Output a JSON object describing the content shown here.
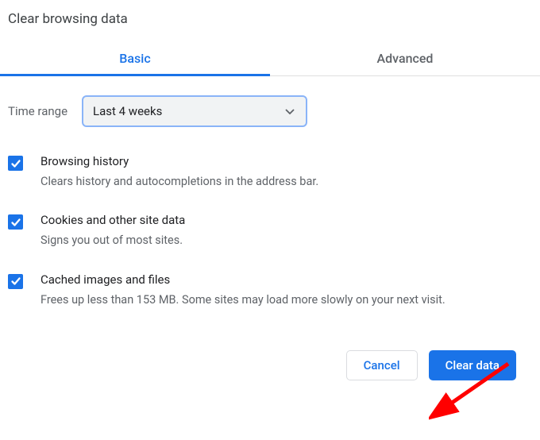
{
  "dialog": {
    "title": "Clear browsing data"
  },
  "tabs": {
    "basic": "Basic",
    "advanced": "Advanced"
  },
  "timeRange": {
    "label": "Time range",
    "selected": "Last 4 weeks"
  },
  "options": [
    {
      "title": "Browsing history",
      "desc": "Clears history and autocompletions in the address bar."
    },
    {
      "title": "Cookies and other site data",
      "desc": "Signs you out of most sites."
    },
    {
      "title": "Cached images and files",
      "desc": "Frees up less than 153 MB. Some sites may load more slowly on your next visit."
    }
  ],
  "buttons": {
    "cancel": "Cancel",
    "clear": "Clear data"
  },
  "colors": {
    "accent": "#1a73e8",
    "muted": "#5f6368",
    "annotation": "#ff0000"
  }
}
